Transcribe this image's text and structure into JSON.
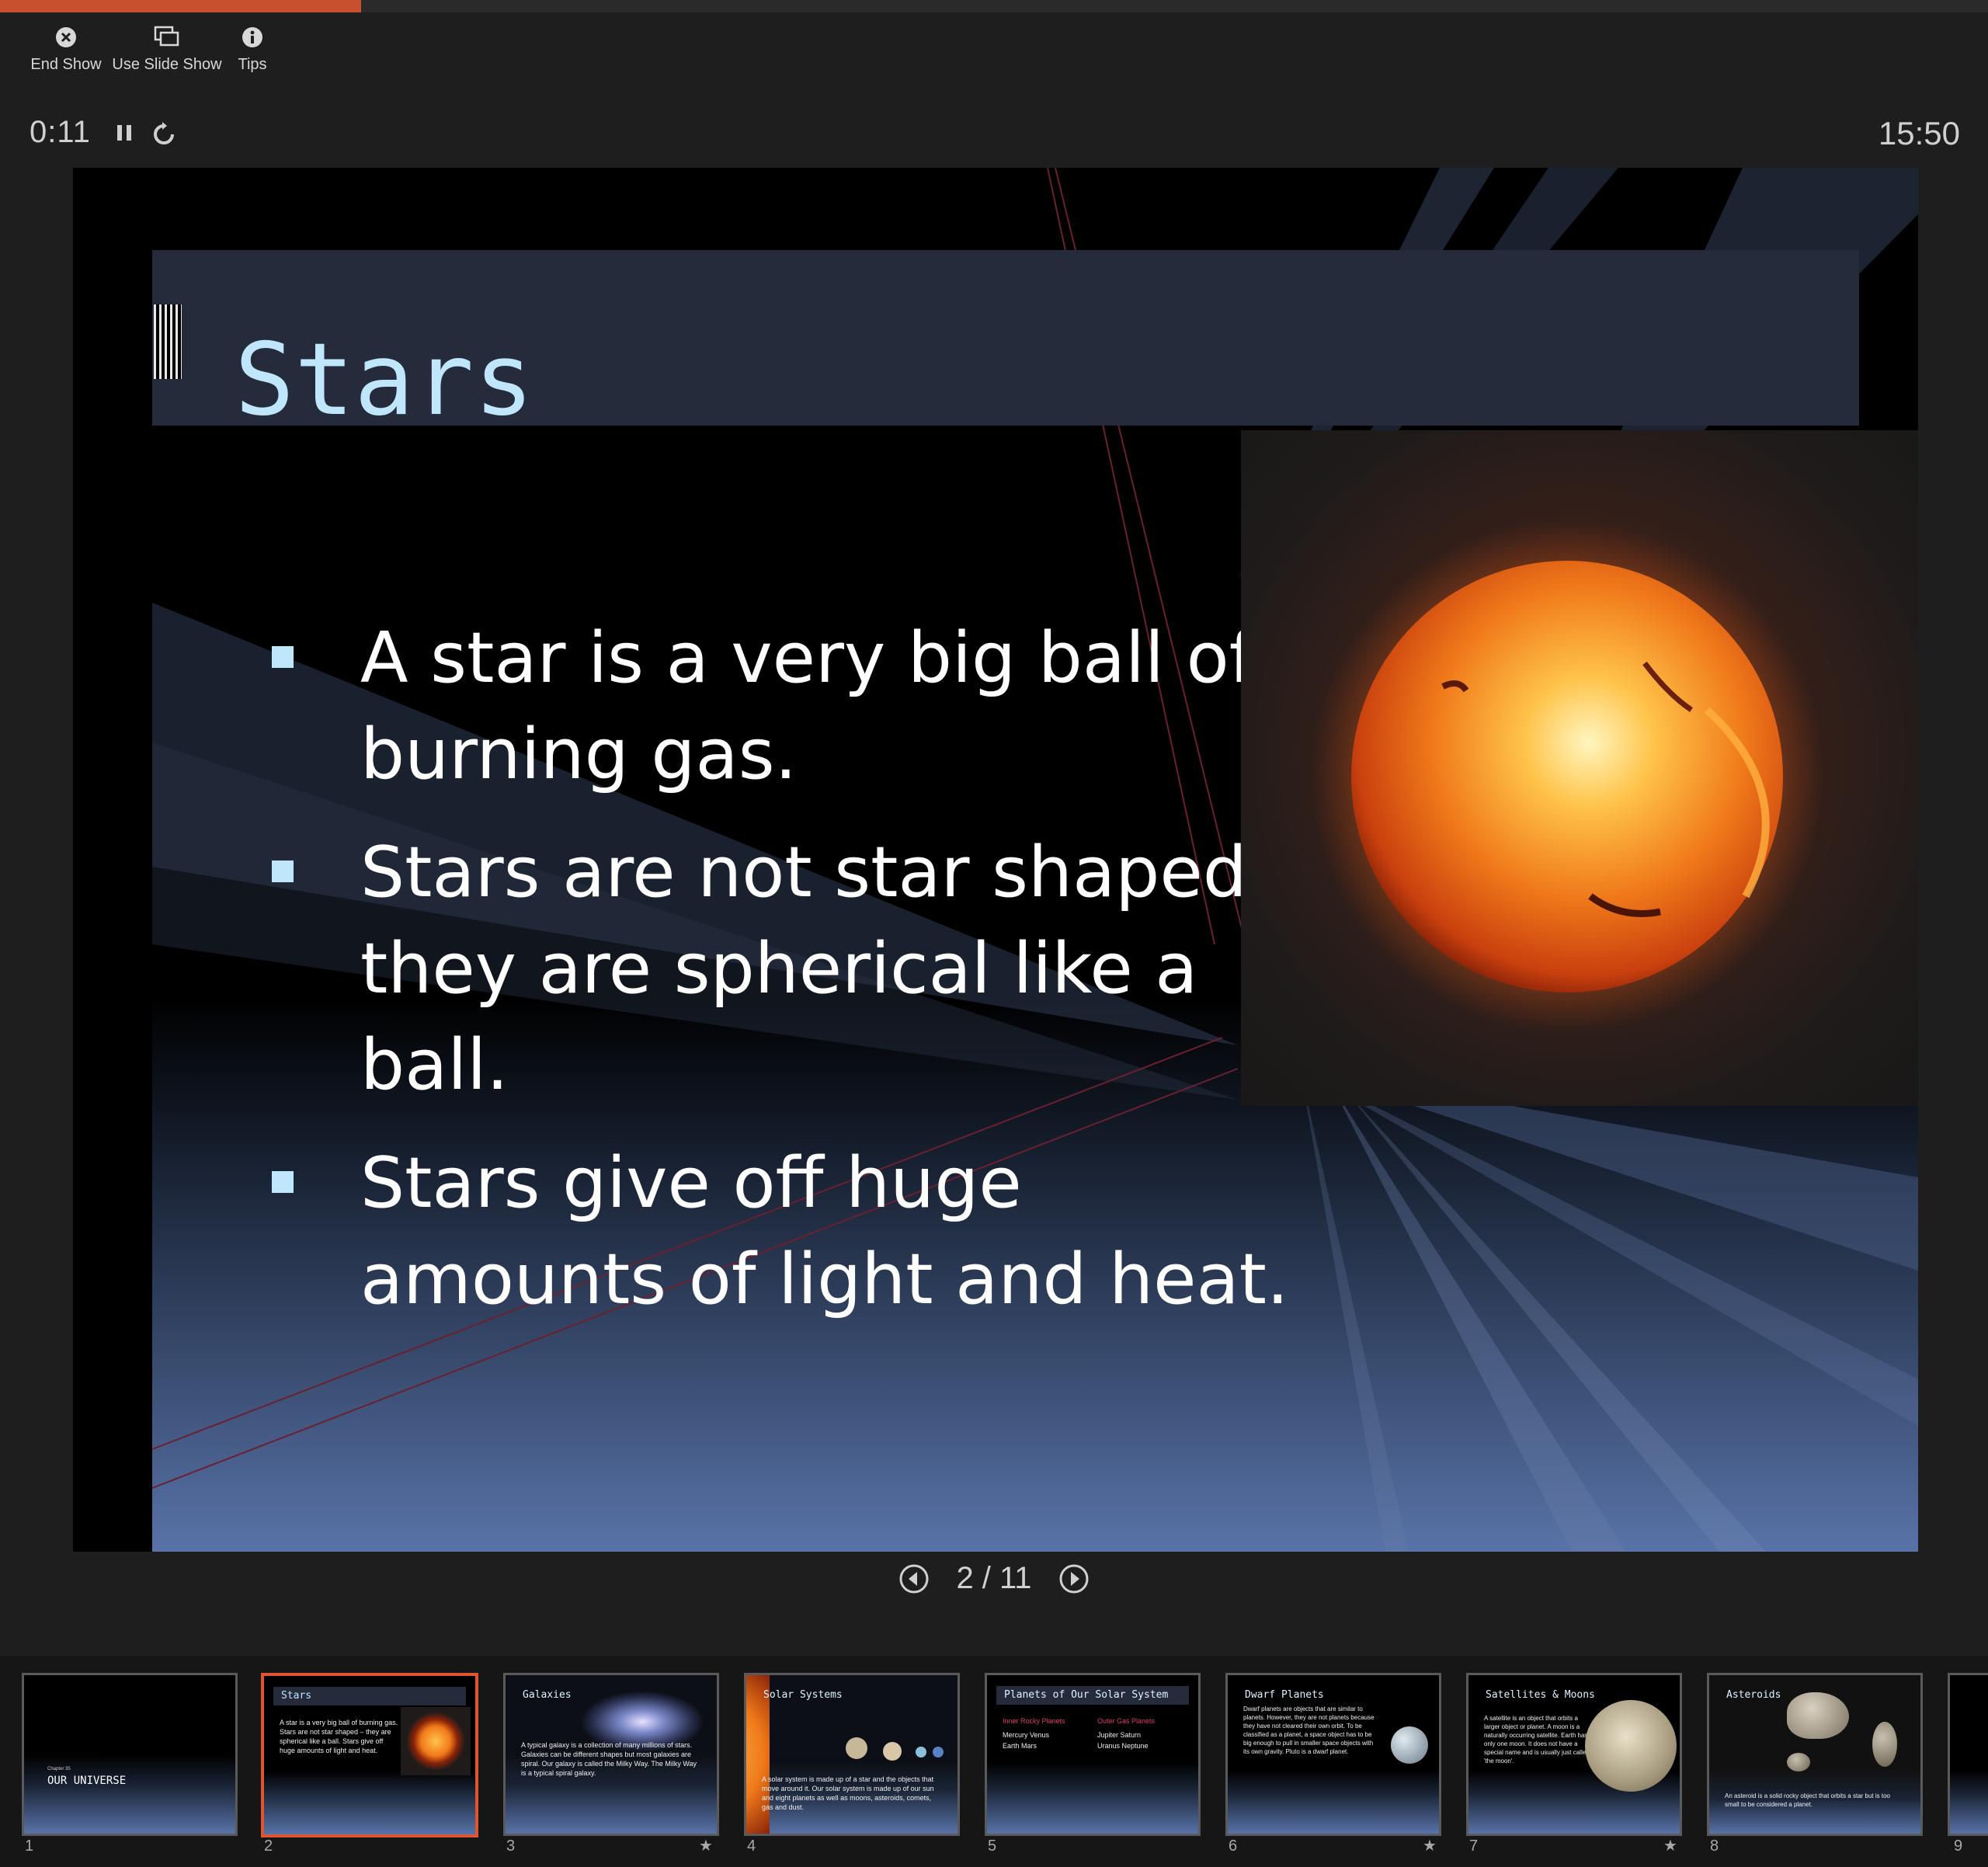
{
  "progress": {
    "fraction": 0.1818
  },
  "toolbar": {
    "end_show": "End Show",
    "use_slide_show": "Use Slide Show",
    "tips": "Tips"
  },
  "timer": {
    "elapsed": "0:11"
  },
  "clock": {
    "time": "15:50"
  },
  "slide": {
    "title": "Stars",
    "bullets": [
      "A star is a very big ball of burning gas.",
      "Stars are not star shaped – they are spherical like a ball.",
      "Stars give off huge amounts of light and heat."
    ]
  },
  "navigation": {
    "counter": "2 / 11"
  },
  "thumbnails": [
    {
      "number": "1",
      "subtitle": "Chapter 35",
      "title": "OUR UNIVERSE"
    },
    {
      "number": "2",
      "title": "Stars",
      "text": "A star is a very big ball of burning gas. Stars are not star shaped – they are spherical like a ball. Stars give off huge amounts of light and heat."
    },
    {
      "number": "3",
      "title": "Galaxies",
      "text": "A typical galaxy is a collection of many millions of stars. Galaxies can be different shapes but most galaxies are spiral. Our galaxy is called the Milky Way. The Milky Way is a typical spiral galaxy.",
      "star": "★"
    },
    {
      "number": "4",
      "title": "Solar Systems",
      "text": "A solar system is made up of a star and the objects that move around it. Our solar system is made up of our sun and eight planets as well as moons, asteroids, comets, gas and dust."
    },
    {
      "number": "5",
      "title": "Planets of Our Solar System",
      "col1_head": "Inner Rocky Planets",
      "col1": "Mercury Venus Earth Mars",
      "col2_head": "Outer Gas Planets",
      "col2": "Jupiter Saturn Uranus Neptune"
    },
    {
      "number": "6",
      "title": "Dwarf Planets",
      "text": "Dwarf planets are objects that are similar to planets. However, they are not planets because they have not cleared their own orbit. To be classified as a planet, a space object has to be big enough to pull in smaller space objects with its own gravity. Pluto is a dwarf planet.",
      "star": "★"
    },
    {
      "number": "7",
      "title": "Satellites & Moons",
      "text": "A satellite is an object that orbits a larger object or planet. A moon is a naturally occurring satellite. Earth has only one moon. It does not have a special name and is usually just called 'the moon'.",
      "star": "★"
    },
    {
      "number": "8",
      "title": "Asteroids",
      "text": "An asteroid is a solid rocky object that orbits a star but is too small to be considered a planet."
    },
    {
      "number": "9"
    }
  ],
  "colors": {
    "accent": "#c8502e",
    "title_text": "#bfe6fb",
    "band": "#252b3a"
  }
}
